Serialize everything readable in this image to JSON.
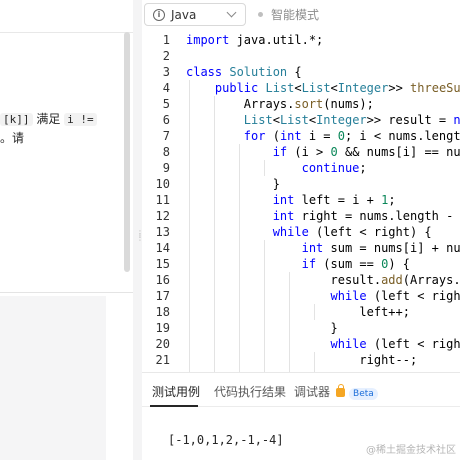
{
  "left": {
    "desc_line1_code1": "[k]]",
    "desc_line1_text": " 满足 ",
    "desc_line1_code2": "i !=",
    "desc_line2_text": "。请"
  },
  "toolbar": {
    "language": "Java",
    "smart_mode": "智能模式"
  },
  "code": {
    "line_numbers": [
      "1",
      "2",
      "3",
      "4",
      "5",
      "6",
      "7",
      "8",
      "9",
      "10",
      "11",
      "12",
      "13",
      "14",
      "15",
      "16",
      "17",
      "18",
      "19",
      "20",
      "21"
    ]
  },
  "console": {
    "tabs": [
      "测试用例",
      "代码执行结果",
      "调试器"
    ],
    "beta_badge": "Beta",
    "case_input": "[-1,0,1,2,-1,-4]"
  },
  "watermark": "@稀土掘金技术社区"
}
